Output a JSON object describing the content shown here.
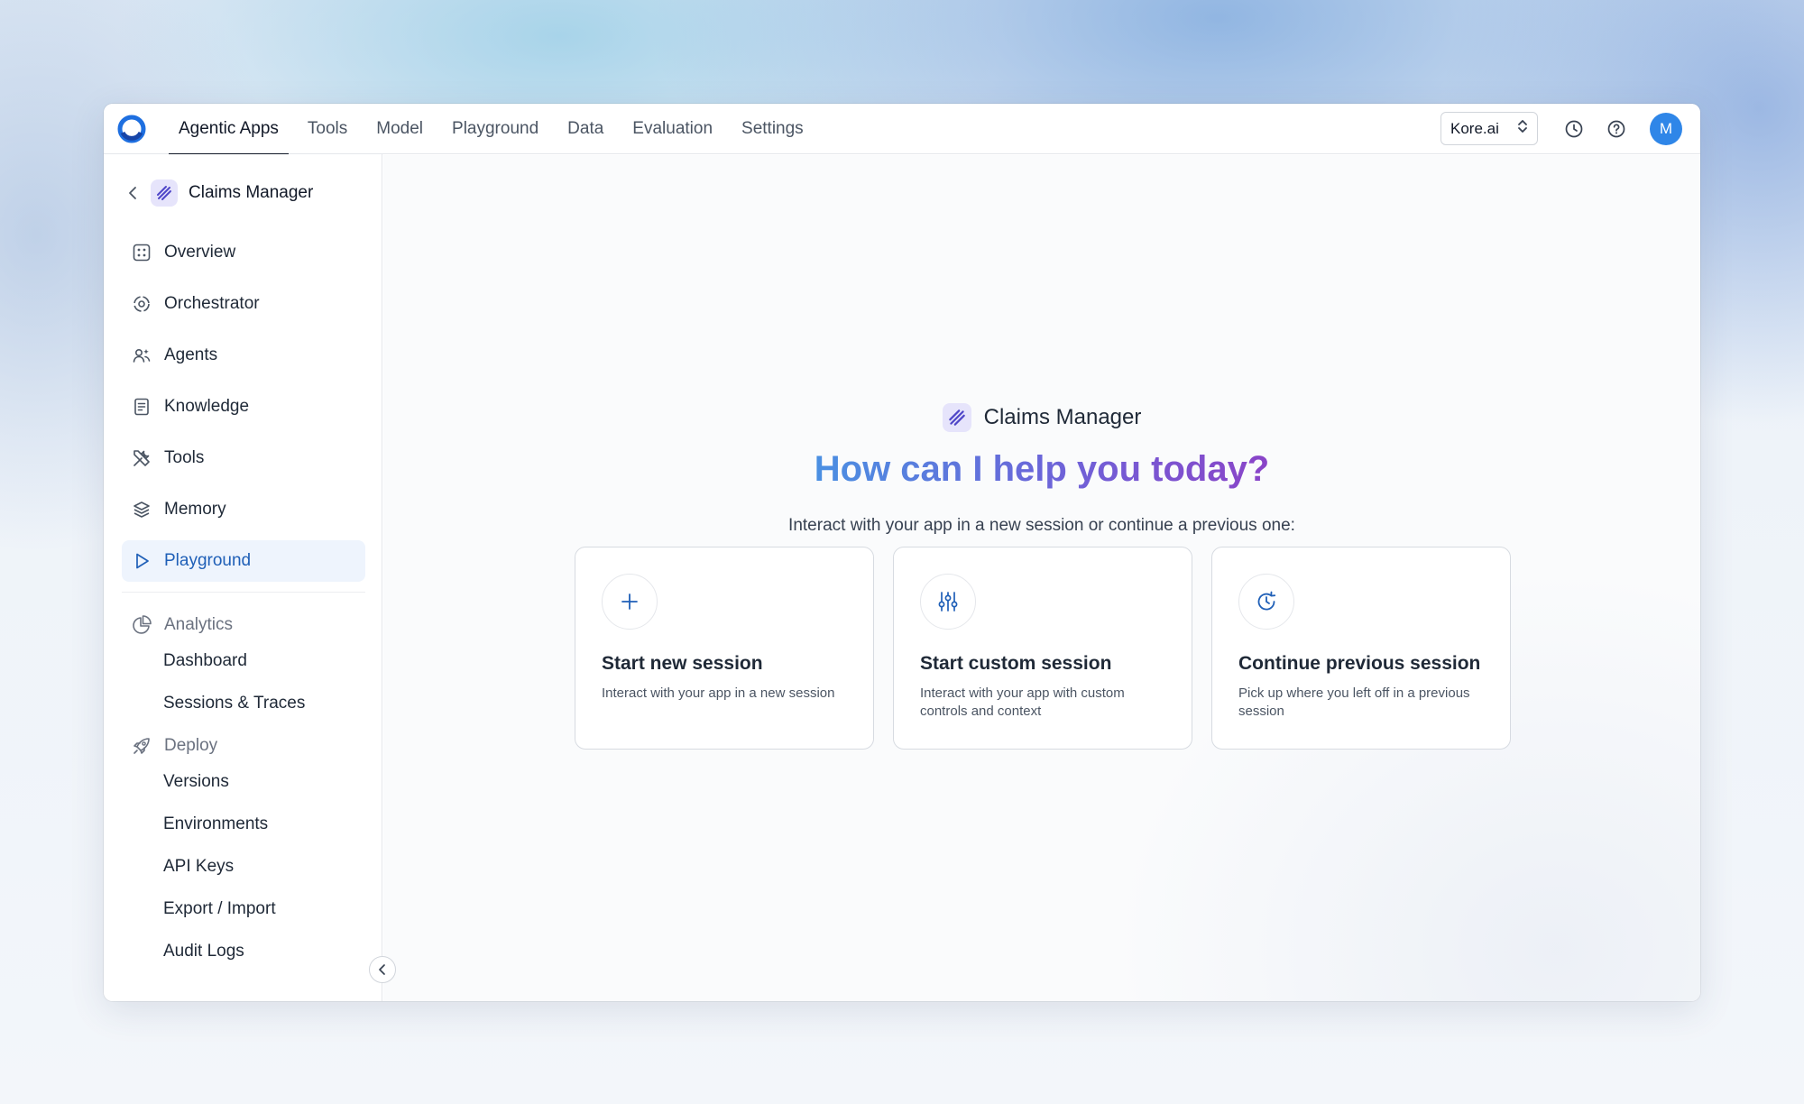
{
  "nav": {
    "items": [
      {
        "label": "Agentic Apps",
        "active": true
      },
      {
        "label": "Tools"
      },
      {
        "label": "Model"
      },
      {
        "label": "Playground"
      },
      {
        "label": "Data"
      },
      {
        "label": "Evaluation"
      },
      {
        "label": "Settings"
      }
    ],
    "org": "Kore.ai",
    "avatar_initial": "M"
  },
  "sidebar": {
    "app_name": "Claims Manager",
    "items": [
      {
        "label": "Overview",
        "icon": "grid-icon"
      },
      {
        "label": "Orchestrator",
        "icon": "orchestrator-icon"
      },
      {
        "label": "Agents",
        "icon": "agents-icon"
      },
      {
        "label": "Knowledge",
        "icon": "document-icon"
      },
      {
        "label": "Tools",
        "icon": "tools-icon"
      },
      {
        "label": "Memory",
        "icon": "layers-icon"
      },
      {
        "label": "Playground",
        "icon": "play-icon",
        "active": true
      }
    ],
    "analytics": {
      "label": "Analytics",
      "items": [
        "Dashboard",
        "Sessions & Traces"
      ]
    },
    "deploy": {
      "label": "Deploy",
      "items": [
        "Versions",
        "Environments",
        "API Keys",
        "Export / Import",
        "Audit Logs"
      ]
    }
  },
  "main": {
    "app_name": "Claims Manager",
    "headline": "How can I help you today?",
    "subtitle": "Interact with your app in a new session or continue a previous one:",
    "cards": [
      {
        "title": "Start new session",
        "description": "Interact with your app in a new session",
        "icon": "plus-icon"
      },
      {
        "title": "Start custom session",
        "description": "Interact with your app with custom controls and context",
        "icon": "sliders-icon"
      },
      {
        "title": "Continue previous session",
        "description": "Pick up where you left off in a previous session",
        "icon": "history-icon"
      }
    ]
  },
  "colors": {
    "accent": "#1f5fb7",
    "avatar": "#2f86e8",
    "active_bg": "#eef4fd",
    "gradient_start": "#4a90e2",
    "gradient_end": "#8a44c8"
  }
}
